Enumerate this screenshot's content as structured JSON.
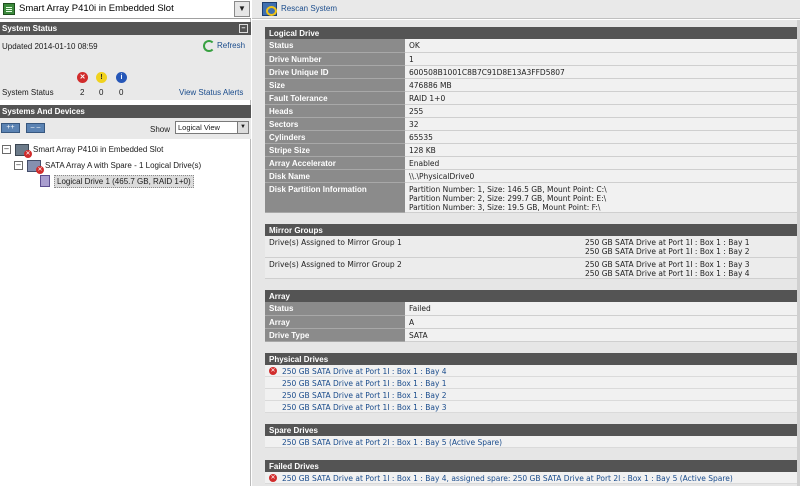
{
  "controller_select": {
    "label": "Smart Array P410i in Embedded Slot",
    "arrow": "▼"
  },
  "toolbar": {
    "rescan_label": "Rescan System"
  },
  "system_status": {
    "title": "System Status",
    "collapse": "–",
    "updated": "Updated 2014-01-10 08:59",
    "refresh_label": "Refresh",
    "status_label": "System Status",
    "critical_count": "2",
    "warning_count": "0",
    "info_count": "0",
    "critical_glyph": "✕",
    "warning_glyph": "!",
    "info_glyph": "i",
    "view_alerts": "View Status Alerts"
  },
  "devices": {
    "title": "Systems And Devices",
    "expand_btn": "++",
    "collapse_btn": "– –",
    "show_label": "Show",
    "view_value": "Logical View",
    "view_arrow": "▼",
    "tree": [
      {
        "label": "Smart Array P410i in Embedded Slot",
        "toggle": "–"
      },
      {
        "label": "SATA Array A with Spare - 1 Logical Drive(s)",
        "toggle": "–"
      },
      {
        "label": "Logical Drive 1 (465.7 GB, RAID 1+0)"
      }
    ]
  },
  "logical_drive": {
    "title": "Logical Drive",
    "rows": [
      {
        "k": "Status",
        "v": "OK"
      },
      {
        "k": "Drive Number",
        "v": "1"
      },
      {
        "k": "Drive Unique ID",
        "v": "600508B1001C8B7C91D8E13A3FFD5807"
      },
      {
        "k": "Size",
        "v": "476886 MB"
      },
      {
        "k": "Fault Tolerance",
        "v": "RAID 1+0"
      },
      {
        "k": "Heads",
        "v": "255"
      },
      {
        "k": "Sectors",
        "v": "32"
      },
      {
        "k": "Cylinders",
        "v": "65535"
      },
      {
        "k": "Stripe Size",
        "v": "128 KB"
      },
      {
        "k": "Array Accelerator",
        "v": "Enabled"
      },
      {
        "k": "Disk Name",
        "v": "\\\\.\\PhysicalDrive0"
      }
    ],
    "partition_key": "Disk Partition Information",
    "partitions": [
      "Partition Number: 1, Size: 146.5 GB, Mount Point: C:\\",
      "Partition Number: 2, Size: 299.7 GB, Mount Point: E:\\",
      "Partition Number: 3, Size: 19.5 GB, Mount Point: F:\\"
    ]
  },
  "mirror_groups": {
    "title": "Mirror Groups",
    "groups": [
      {
        "label": "Drive(s) Assigned to Mirror Group 1",
        "drives": [
          "250 GB SATA Drive at Port 1I : Box 1 : Bay 1",
          "250 GB SATA Drive at Port 1I : Box 1 : Bay 2"
        ]
      },
      {
        "label": "Drive(s) Assigned to Mirror Group 2",
        "drives": [
          "250 GB SATA Drive at Port 1I : Box 1 : Bay 3",
          "250 GB SATA Drive at Port 1I : Box 1 : Bay 4"
        ]
      }
    ]
  },
  "array": {
    "title": "Array",
    "rows": [
      {
        "k": "Status",
        "v": "Failed"
      },
      {
        "k": "Array",
        "v": "A"
      },
      {
        "k": "Drive Type",
        "v": "SATA"
      }
    ]
  },
  "physical_drives": {
    "title": "Physical Drives",
    "failed_glyph": "✕",
    "items": [
      "250 GB SATA Drive at Port 1I : Box 1 : Bay 4",
      "250 GB SATA Drive at Port 1I : Box 1 : Bay 1",
      "250 GB SATA Drive at Port 1I : Box 1 : Bay 2",
      "250 GB SATA Drive at Port 1I : Box 1 : Bay 3"
    ]
  },
  "spare_drives": {
    "title": "Spare Drives",
    "items": [
      "250 GB SATA Drive at Port 2I : Box 1 : Bay 5 (Active Spare)"
    ]
  },
  "failed_drives": {
    "title": "Failed Drives",
    "failed_glyph": "✕",
    "items": [
      "250 GB SATA Drive at Port 1I : Box 1 : Bay 4, assigned spare: 250 GB SATA Drive at Port 2I : Box 1 : Bay 5 (Active Spare)"
    ]
  },
  "colors": {
    "header_bg": "#545454",
    "key_bg": "#8b8b8b",
    "link": "#1a4c8c",
    "critical": "#d12c2c"
  }
}
